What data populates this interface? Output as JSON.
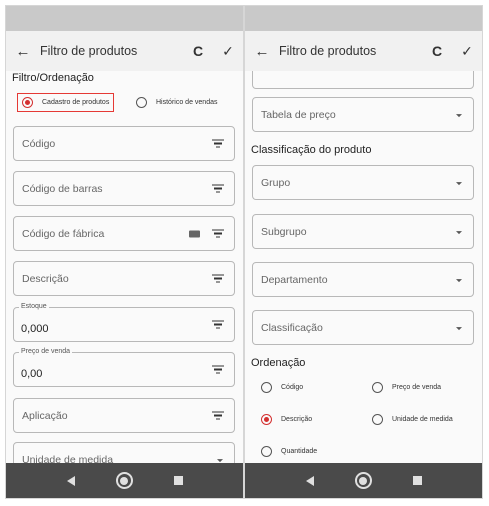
{
  "colors": {
    "accent": "#d32f2f",
    "statusbar": "#c9c9c9",
    "toolbar": "#f1f1f1",
    "navbar": "#4a4a4a"
  },
  "left": {
    "toolbar": {
      "title": "Filtro de produtos",
      "back_icon": "←",
      "refresh_icon": "C",
      "confirm_icon": "✓"
    },
    "section_filter": "Filtro/Ordenação",
    "source_options": [
      {
        "label": "Cadastro de produtos",
        "selected": true
      },
      {
        "label": "Histórico de vendas",
        "selected": false
      }
    ],
    "fields": {
      "codigo": {
        "placeholder": "Código"
      },
      "codigo_barras": {
        "placeholder": "Código de barras"
      },
      "codigo_fabrica": {
        "placeholder": "Código de fábrica"
      },
      "descricao": {
        "placeholder": "Descrição"
      },
      "estoque": {
        "label": "Estoque",
        "value": "0,000"
      },
      "preco_venda": {
        "label": "Preço de venda",
        "value": "0,00"
      },
      "aplicacao": {
        "placeholder": "Aplicação"
      },
      "unidade_medida": {
        "placeholder": "Unidade de medida"
      }
    }
  },
  "right": {
    "toolbar": {
      "title": "Filtro de produtos",
      "back_icon": "←",
      "refresh_icon": "C",
      "confirm_icon": "✓"
    },
    "fields": {
      "tabela_preco": {
        "placeholder": "Tabela de preço"
      },
      "grupo": {
        "placeholder": "Grupo"
      },
      "subgrupo": {
        "placeholder": "Subgrupo"
      },
      "departamento": {
        "placeholder": "Departamento"
      },
      "classificacao": {
        "placeholder": "Classificação"
      }
    },
    "section_classificacao": "Classificação do produto",
    "section_ordenacao": "Ordenação",
    "ordering_options": [
      {
        "label": "Código",
        "selected": false
      },
      {
        "label": "Preço de venda",
        "selected": false
      },
      {
        "label": "Descrição",
        "selected": true
      },
      {
        "label": "Unidade de medida",
        "selected": false
      },
      {
        "label": "Quantidade",
        "selected": false
      }
    ]
  }
}
